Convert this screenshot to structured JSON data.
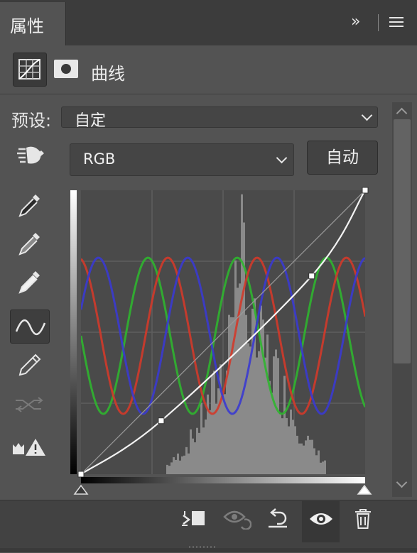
{
  "panel": {
    "tab_title": "属性"
  },
  "header": {
    "adjustment_title": "曲线",
    "adjustment_icon": "curves-grid-icon",
    "mask_icon": "layer-mask-icon"
  },
  "preset": {
    "label": "预设:",
    "value": "自定"
  },
  "channel": {
    "value": "RGB"
  },
  "auto_button": {
    "label": "自动"
  },
  "tools": [
    "target-adjust-hand-icon",
    "black-point-eyedropper-icon",
    "gray-point-eyedropper-icon",
    "white-point-eyedropper-icon",
    "edit-curve-points-icon",
    "pencil-draw-icon",
    "smooth-curve-icon",
    "clipping-warning-icon"
  ],
  "curve_points": [
    [
      0,
      0
    ],
    [
      72,
      48
    ],
    [
      207,
      178
    ],
    [
      255,
      255
    ]
  ],
  "colors": {
    "panel_bg": "#535353",
    "graph_bg": "#4a4a4a",
    "red_wave": "#d23a2a",
    "green_wave": "#2fb52f",
    "blue_wave": "#3a3ad0",
    "curve": "#f2f2f2",
    "histogram": "#8a8a8a"
  },
  "footer_icons": [
    "clip-to-layer-icon",
    "view-previous-state-icon",
    "reset-icon",
    "visibility-eye-icon",
    "delete-trash-icon"
  ]
}
